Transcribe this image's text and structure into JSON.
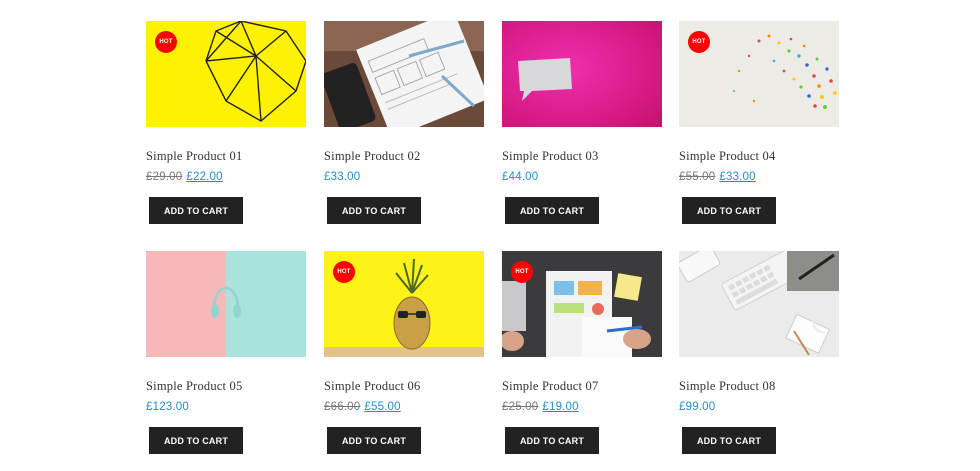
{
  "products": [
    {
      "title": "Simple Product 01",
      "old_price": "£29.00",
      "price": "£22.00",
      "badge": "HOT",
      "button": "ADD TO CART"
    },
    {
      "title": "Simple Product 02",
      "old_price": "",
      "price": "£33.00",
      "badge": "",
      "button": "ADD TO CART"
    },
    {
      "title": "Simple Product 03",
      "old_price": "",
      "price": "£44.00",
      "badge": "",
      "button": "ADD TO CART"
    },
    {
      "title": "Simple Product 04",
      "old_price": "£55.00",
      "price": "£33.00",
      "badge": "HOT",
      "button": "ADD TO CART"
    },
    {
      "title": "Simple Product 05",
      "old_price": "",
      "price": "£123.00",
      "badge": "",
      "button": "ADD TO CART"
    },
    {
      "title": "Simple Product 06",
      "old_price": "£66.00",
      "price": "£55.00",
      "badge": "HOT",
      "button": "ADD TO CART"
    },
    {
      "title": "Simple Product 07",
      "old_price": "£25.00",
      "price": "£19.00",
      "badge": "HOT",
      "button": "ADD TO CART"
    },
    {
      "title": "Simple Product 08",
      "old_price": "",
      "price": "£99.00",
      "badge": "",
      "button": "ADD TO CART"
    }
  ],
  "colors": {
    "accent": "#1e90c8",
    "badge": "#ff0000",
    "button": "#222222"
  }
}
